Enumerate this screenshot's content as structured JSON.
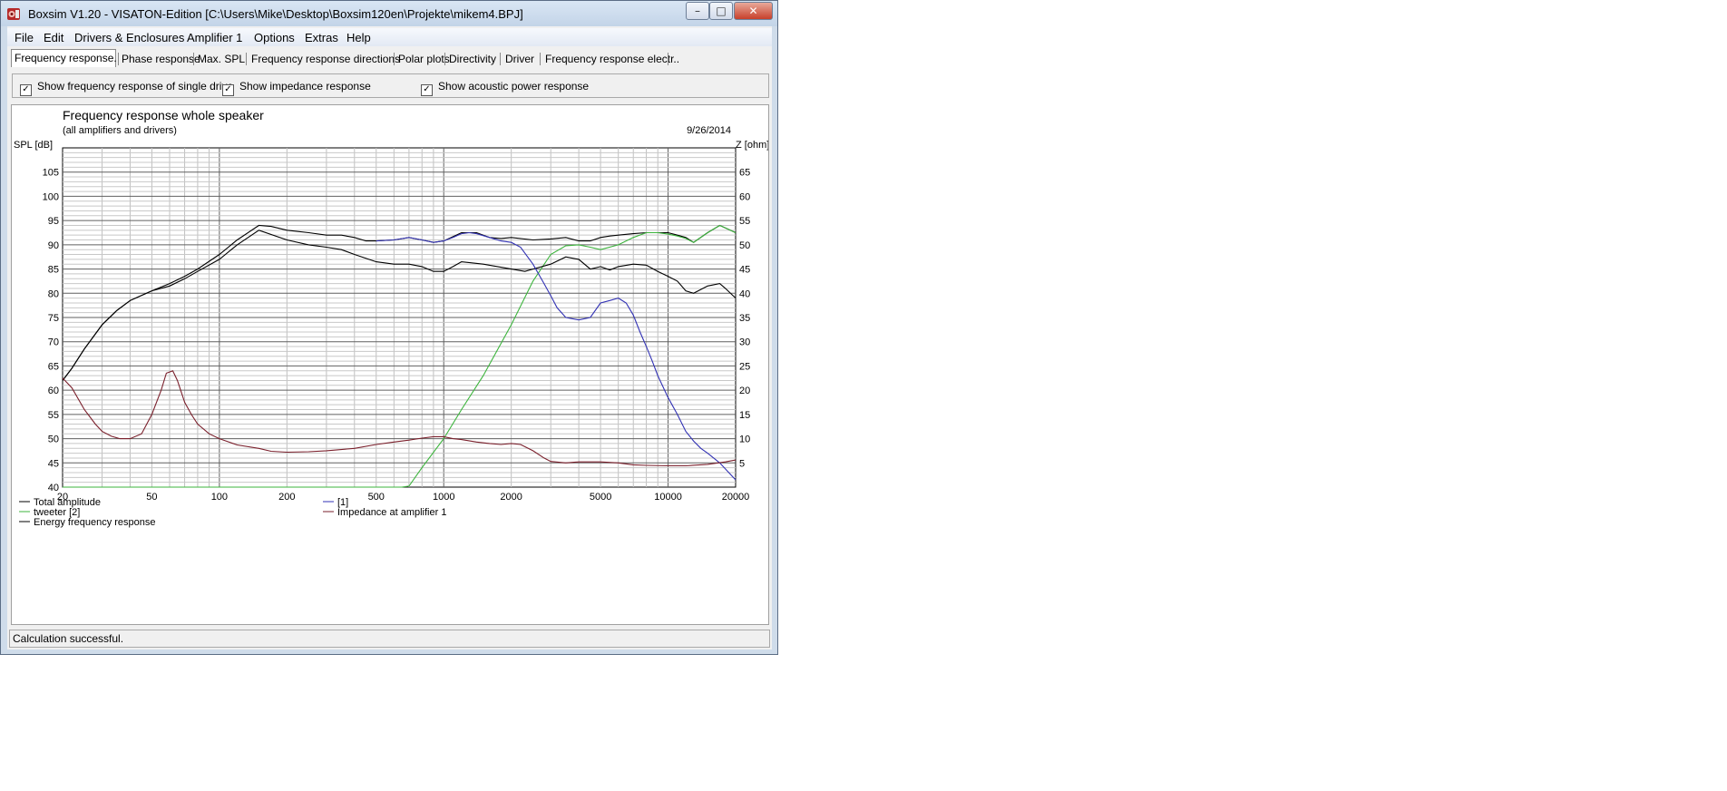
{
  "window": {
    "title": "Boxsim V1.20 - VISATON-Edition [C:\\Users\\Mike\\Desktop\\Boxsim120en\\Projekte\\mikem4.BPJ]"
  },
  "menu": [
    "File",
    "Edit",
    "Drivers & Enclosures",
    "Amplifier 1",
    "Options",
    "Extras",
    "Help"
  ],
  "tabs": [
    "Frequency response.",
    "Phase response",
    "Max. SPL",
    "Frequency response directions",
    "Polar plots",
    "Directivity",
    "Driver",
    "Frequency response electr.."
  ],
  "options": [
    {
      "label": "Show frequency response of single drive",
      "checked": true
    },
    {
      "label": "Show impedance response",
      "checked": true
    },
    {
      "label": "Show acoustic power response",
      "checked": true
    }
  ],
  "status": "Calculation successful.",
  "chart_data": {
    "type": "line",
    "title": "Frequency response whole speaker",
    "subtitle": "(all amplifiers and drivers)",
    "date": "9/26/2014",
    "ylabel": "SPL [dB]",
    "y2label": "Z [ohm]",
    "x_scale": "log",
    "xlim": [
      20,
      20000
    ],
    "ylim": [
      40,
      110
    ],
    "y2lim": [
      0,
      70
    ],
    "x_ticks": [
      20,
      50,
      100,
      200,
      500,
      1000,
      2000,
      5000,
      10000,
      20000
    ],
    "y_ticks": [
      40,
      45,
      50,
      55,
      60,
      65,
      70,
      75,
      80,
      85,
      90,
      95,
      100,
      105
    ],
    "y2_ticks": [
      5,
      10,
      15,
      20,
      25,
      30,
      35,
      40,
      45,
      50,
      55,
      60,
      65
    ],
    "grid": true,
    "legend_placement": "bottom",
    "series": [
      {
        "name": "Total amplitude",
        "axis": "left",
        "color": "#000000",
        "legend_col": 0,
        "legend_row": 0,
        "x": [
          20,
          22,
          25,
          30,
          35,
          40,
          50,
          60,
          70,
          80,
          100,
          120,
          150,
          170,
          200,
          250,
          300,
          350,
          400,
          450,
          500,
          600,
          700,
          800,
          900,
          1000,
          1200,
          1400,
          1600,
          1800,
          2000,
          2500,
          3000,
          3500,
          4000,
          4500,
          5000,
          5500,
          6000,
          7000,
          8000,
          9000,
          10000,
          11000,
          12000,
          13000,
          15000,
          17000,
          18000,
          20000
        ],
        "y": [
          62,
          64.5,
          68.5,
          73.5,
          76.5,
          78.5,
          80.5,
          82,
          83.5,
          85,
          88,
          91,
          94,
          93.8,
          93,
          92.5,
          92,
          92,
          91.5,
          90.8,
          90.8,
          91,
          91.5,
          91,
          90.5,
          90.8,
          92.5,
          92.5,
          91.5,
          91.3,
          91.5,
          91,
          91.2,
          91.5,
          90.8,
          90.8,
          91.5,
          91.8,
          92,
          92.3,
          92.5,
          92.5,
          92.5,
          92,
          91.5,
          90.5,
          92.5,
          94,
          93.5,
          92.5
        ]
      },
      {
        "name": "tweeter  [2]",
        "axis": "left",
        "color": "#3cb43c",
        "legend_col": 0,
        "legend_row": 1,
        "x": [
          20,
          650,
          700,
          800,
          1000,
          1200,
          1500,
          2000,
          2500,
          3000,
          3500,
          4000,
          4500,
          5000,
          6000,
          7000,
          8000,
          9000,
          10000,
          11000,
          12000,
          13000,
          15000,
          17000,
          18000,
          20000
        ],
        "y": [
          40,
          40,
          40.2,
          44,
          50,
          56,
          63,
          73.5,
          82.5,
          88,
          89.8,
          90,
          89.5,
          89,
          90,
          91.5,
          92.5,
          92.5,
          92.2,
          91.8,
          91.3,
          90.5,
          92.5,
          94,
          93.5,
          92.5
        ]
      },
      {
        "name": "Energy frequency response",
        "axis": "left",
        "color": "#000000",
        "legend_col": 0,
        "legend_row": 2,
        "x": [
          20,
          22,
          25,
          30,
          35,
          40,
          50,
          60,
          70,
          80,
          100,
          120,
          150,
          200,
          250,
          300,
          350,
          400,
          500,
          600,
          700,
          800,
          900,
          1000,
          1100,
          1200,
          1500,
          2000,
          2300,
          2500,
          3000,
          3500,
          4000,
          4500,
          5000,
          5500,
          6000,
          7000,
          8000,
          9000,
          10000,
          11000,
          12000,
          13000,
          15000,
          17000,
          18000,
          20000
        ],
        "y": [
          62,
          64.5,
          68.5,
          73.5,
          76.5,
          78.5,
          80.5,
          81.5,
          83,
          84.5,
          87,
          90,
          93,
          91,
          90,
          89.5,
          89,
          88,
          86.5,
          86,
          86,
          85.5,
          84.5,
          84.5,
          85.5,
          86.5,
          86,
          85,
          84.5,
          85,
          86,
          87.5,
          87,
          85,
          85.5,
          84.8,
          85.5,
          86,
          85.8,
          84.5,
          83.5,
          82.5,
          80.5,
          80,
          81.5,
          82,
          81,
          79
        ]
      },
      {
        "name": "[1]",
        "axis": "left",
        "color": "#3232b4",
        "legend_col": 1,
        "legend_row": 0,
        "x": [
          500,
          600,
          700,
          800,
          900,
          1000,
          1100,
          1200,
          1300,
          1400,
          1600,
          1800,
          2000,
          2200,
          2500,
          2800,
          3000,
          3200,
          3500,
          4000,
          4500,
          5000,
          5500,
          6000,
          6500,
          7000,
          7500,
          8000,
          8500,
          9000,
          10000,
          11000,
          12000,
          13000,
          14000,
          15000,
          17000,
          20000
        ],
        "y": [
          90.8,
          91,
          91.5,
          91,
          90.5,
          90.8,
          91.5,
          92.3,
          92.5,
          92.3,
          91.5,
          90.8,
          90.5,
          89.5,
          86,
          82,
          79.5,
          77,
          75,
          74.5,
          75,
          78,
          78.5,
          79,
          78,
          75.5,
          72,
          69,
          66,
          63,
          58.5,
          55,
          51.5,
          49.5,
          48,
          47,
          45,
          41.5
        ]
      },
      {
        "name": "Impedance at amplifier 1",
        "axis": "right",
        "color": "#7a1f2b",
        "legend_col": 1,
        "legend_row": 1,
        "x": [
          20,
          22,
          25,
          28,
          30,
          33,
          36,
          40,
          45,
          50,
          55,
          58,
          62,
          65,
          70,
          75,
          80,
          90,
          100,
          120,
          150,
          170,
          200,
          250,
          300,
          400,
          500,
          600,
          700,
          800,
          900,
          1000,
          1100,
          1200,
          1400,
          1600,
          1800,
          2000,
          2200,
          2500,
          2800,
          3000,
          3500,
          4000,
          5000,
          6000,
          7000,
          8000,
          10000,
          12000,
          15000,
          18000,
          20000
        ],
        "y": [
          22.5,
          20.5,
          16,
          13,
          11.5,
          10.5,
          10,
          10,
          11,
          15,
          20,
          23.5,
          24,
          22,
          17.5,
          15,
          13,
          11,
          10,
          8.7,
          8,
          7.4,
          7.2,
          7.3,
          7.5,
          8,
          8.8,
          9.3,
          9.7,
          10.1,
          10.4,
          10.4,
          10,
          9.8,
          9.3,
          9,
          8.8,
          9,
          8.8,
          7.5,
          6,
          5.3,
          5,
          5.2,
          5.2,
          5,
          4.6,
          4.5,
          4.4,
          4.4,
          4.7,
          5.2,
          5.6
        ]
      }
    ]
  }
}
